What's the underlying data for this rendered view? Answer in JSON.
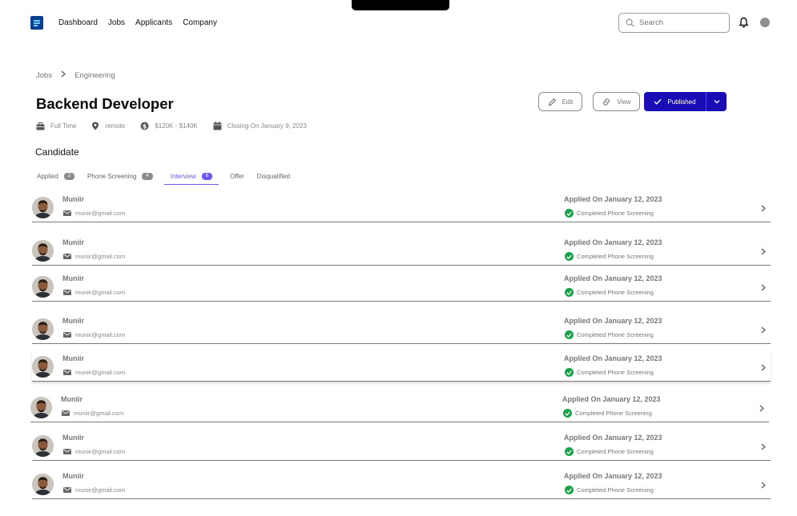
{
  "nav": {
    "links": [
      "Dashboard",
      "Jobs",
      "Applicants",
      "Company"
    ],
    "search_placeholder": "Search"
  },
  "breadcrumb": [
    "Jobs",
    "Engineering"
  ],
  "job": {
    "title": "Backend Developer",
    "employment_type": "Full Time",
    "location": "remote",
    "salary": "$120K - $140K",
    "closing": "Closing On January 9, 2023"
  },
  "actions": {
    "edit": "Edit",
    "view": "View",
    "publish": "Published"
  },
  "section_title": "Candidate",
  "tabs": [
    {
      "label": "Applied",
      "count": "2"
    },
    {
      "label": "Phone Screening",
      "count": "4"
    },
    {
      "label": "Interview",
      "count": "6"
    },
    {
      "label": "Offer"
    },
    {
      "label": "Disqualified"
    }
  ],
  "candidates": [
    {
      "name": "Muniir",
      "email": "muniir@gmail.com",
      "applied": "Applied On January 12, 2023",
      "status": "Completed Phone Screening"
    },
    {
      "name": "Muniir",
      "email": "muniir@gmail.com",
      "applied": "Applied On January 12, 2023",
      "status": "Completed Phone Screening"
    },
    {
      "name": "Muniir",
      "email": "muniir@gmail.com",
      "applied": "Applied On January 12, 2023",
      "status": "Completed Phone Screening"
    },
    {
      "name": "Muniir",
      "email": "muniir@gmail.com",
      "applied": "Applied On January 12, 2023",
      "status": "Completed Phone Screening"
    },
    {
      "name": "Muniir",
      "email": "muniir@gmail.com",
      "applied": "Applied On January 12, 2023",
      "status": "Completed Phone Screening"
    },
    {
      "name": "Muniir",
      "email": "muniir@gmail.com",
      "applied": "Applied On January 12, 2023",
      "status": "Completed Phone Screening"
    },
    {
      "name": "Muniir",
      "email": "muniir@gmail.com",
      "applied": "Applied On January 12, 2023",
      "status": "Completed Phone Screening"
    },
    {
      "name": "Muniir",
      "email": "muniir@gmail.com",
      "applied": "Applied On January 12, 2023",
      "status": "Completed Phone Screening"
    }
  ],
  "colors": {
    "primary": "#1a0db5",
    "accent_tab": "#6f57e9",
    "success": "#16a34a"
  },
  "icons": [
    "logo-icon",
    "search-icon",
    "bell-icon",
    "briefcase-icon",
    "location-pin-icon",
    "dollar-icon",
    "calendar-icon",
    "pencil-icon",
    "link-icon",
    "check-icon",
    "chevron-down-icon",
    "mail-icon",
    "check-circle-icon",
    "chevron-right-icon"
  ]
}
